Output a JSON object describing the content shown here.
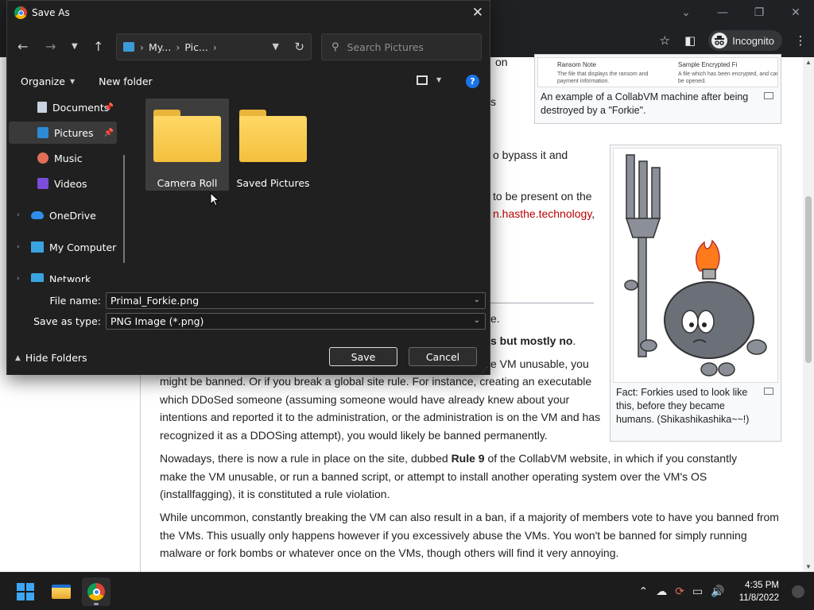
{
  "browser": {
    "incognito_label": "Incognito",
    "win_min": "—",
    "win_max": "❐",
    "win_close": "✕",
    "chevron": "⌄"
  },
  "page": {
    "fragments": {
      "f1": "on",
      "f2": "s",
      "f3": "o bypass it and",
      "f4": "to be present on the",
      "f5_link": "n.hasthe.technology",
      "f5_tail": ",",
      "f6": "e.",
      "f7_bold": "s but mostly no",
      "f7_tail": ".",
      "f8": "e VM unusable, you"
    },
    "para1": "might be banned. Or if you break a global site rule. For instance, creating an executable which DDoSed someone (assuming someone would have already knew about your intentions and reported it to the administration, or the administration is on the VM and has recognized it as a DDOSing attempt), you would likely be banned permanently.",
    "para2_pre": "Nowadays, there is now a rule in place on the site, dubbed ",
    "para2_bold": "Rule 9",
    "para2_post": " of the CollabVM website, in which if you constantly make the VM unusable, or run a banned script, or attempt to install another operating system over the VM's OS (installfagging), it is constituted a rule violation.",
    "para3": "While uncommon, constantly breaking the VM can also result in a ban, if a majority of members vote to have you banned from the VMs. This usually only happens however if you excessively abuse the VMs. You won't be banned for simply running malware or fork bombs or whatever once on the VMs, though others will find it very annoying.",
    "thumb1_label_a": "Ransom Note",
    "thumb1_label_b": "Sample Encrypted Fi",
    "thumb1_sub_a": "The file that displays the ransom and payment information.",
    "thumb1_sub_b": "A file which has been encrypted, and can be opened.",
    "thumb1_caption": "An example of a CollabVM machine after being destroyed by a \"Forkie\".",
    "thumb2_caption": "Fact: Forkies used to look like this, before they became humans. (Shikashikashika~~!)"
  },
  "dialog": {
    "title": "Save As",
    "close": "✕",
    "breadcrumb": [
      "My...",
      "Pic..."
    ],
    "search_placeholder": "Search Pictures",
    "organize": "Organize",
    "new_folder": "New folder",
    "help": "?",
    "sidebar": [
      {
        "label": "Documents",
        "icon": "documents-icon"
      },
      {
        "label": "Pictures",
        "icon": "pictures-icon"
      },
      {
        "label": "Music",
        "icon": "music-icon"
      },
      {
        "label": "Videos",
        "icon": "videos-icon"
      },
      {
        "label": "OneDrive",
        "icon": "onedrive-icon"
      },
      {
        "label": "My Computer",
        "icon": "computer-icon"
      },
      {
        "label": "Network",
        "icon": "network-icon"
      }
    ],
    "folders": [
      {
        "name": "Camera Roll"
      },
      {
        "name": "Saved Pictures"
      }
    ],
    "file_name_label": "File name:",
    "file_name_value": "Primal_Forkie.png",
    "save_type_label": "Save as type:",
    "save_type_value": "PNG Image (*.png)",
    "hide_folders": "Hide Folders",
    "save": "Save",
    "cancel": "Cancel"
  },
  "taskbar": {
    "time": "4:35 PM",
    "date": "11/8/2022"
  },
  "colors": {
    "dialog_bg": "#202020",
    "accent": "#1a73e8",
    "folder": "#f3c03c",
    "link": "#ba0000"
  }
}
